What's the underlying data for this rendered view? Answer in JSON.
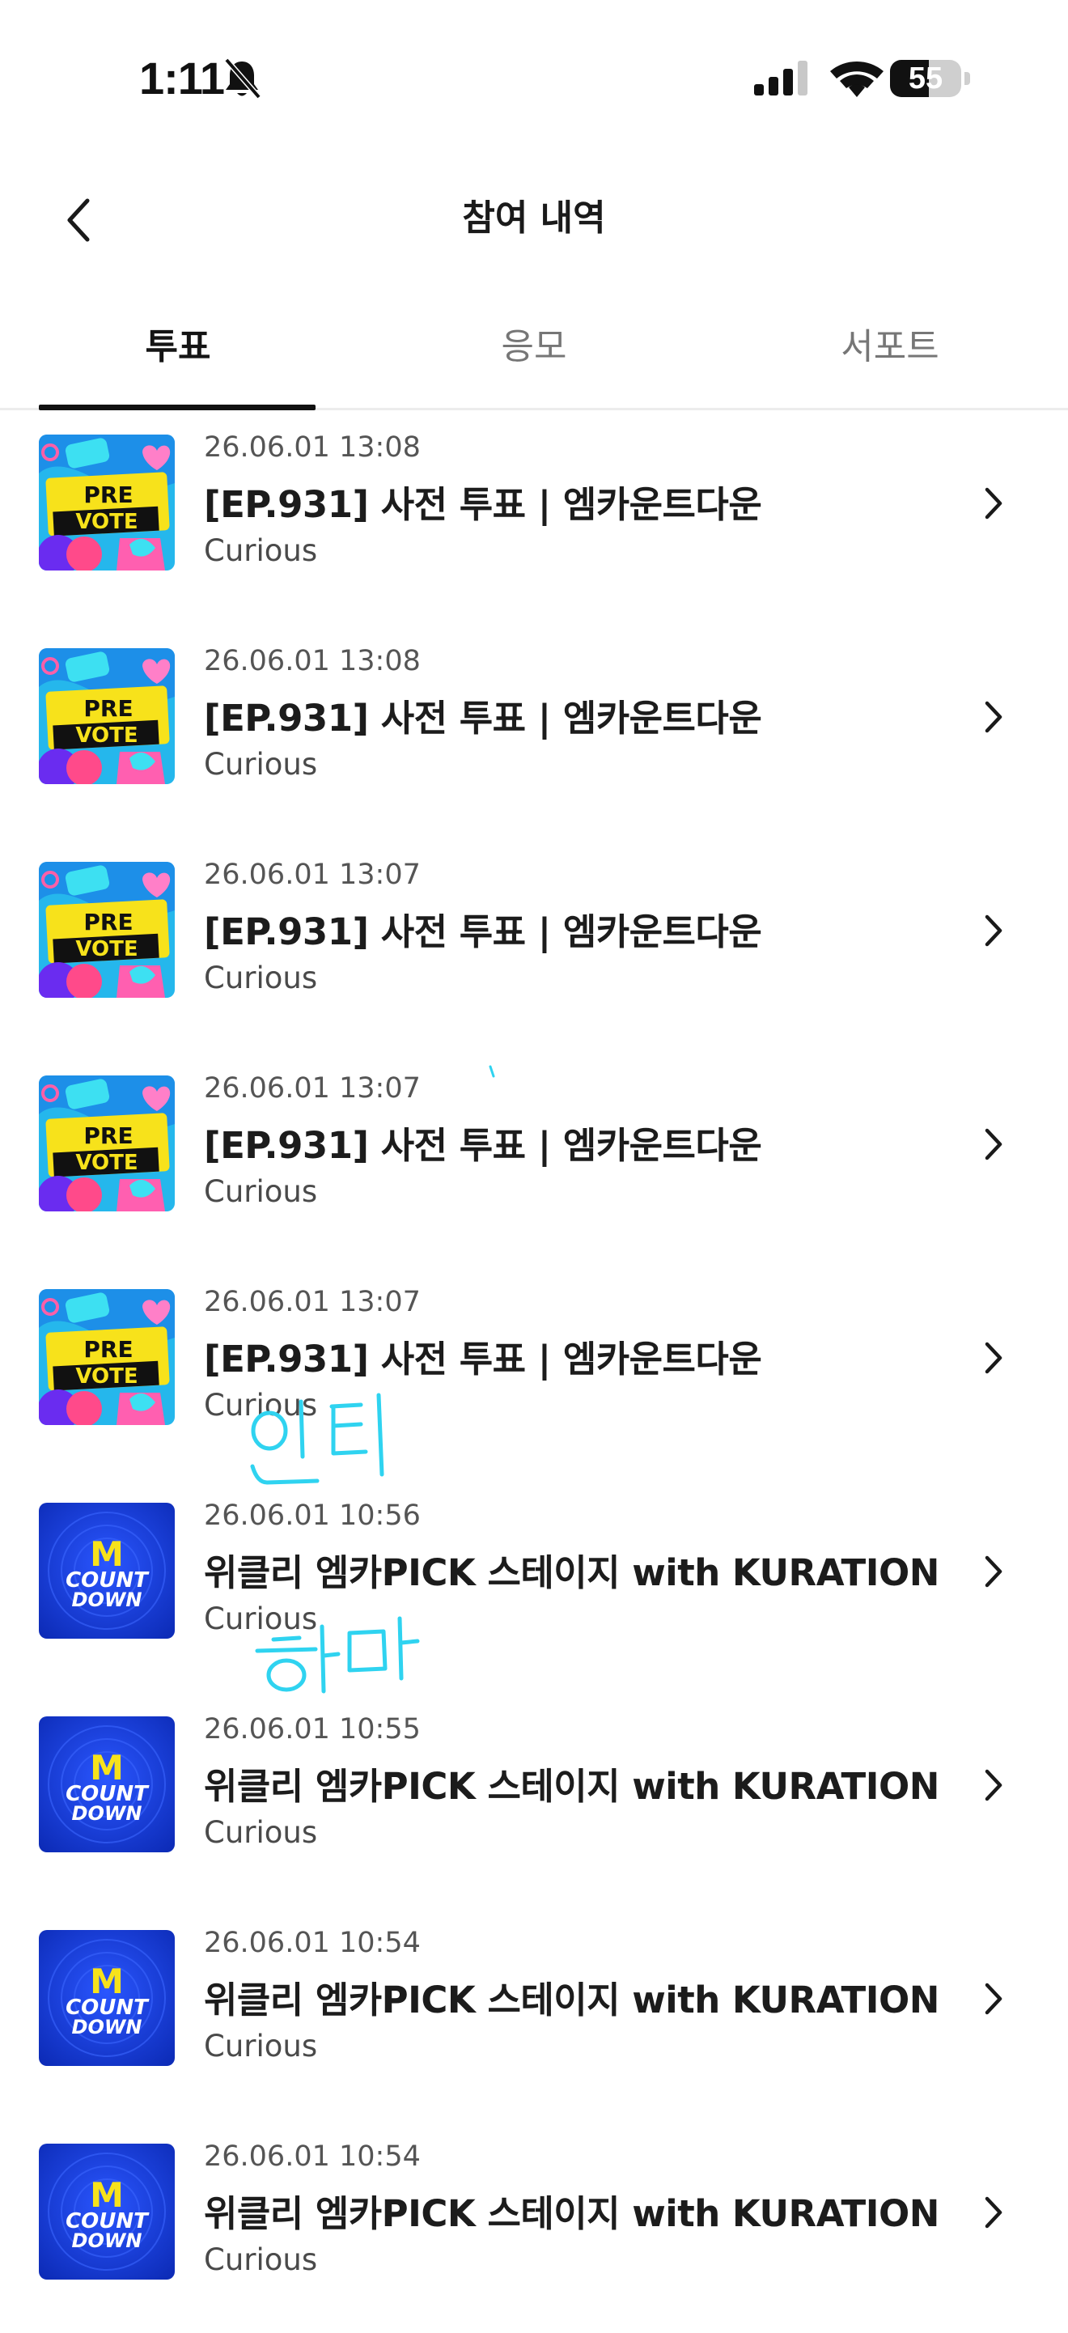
{
  "status_bar": {
    "time": "1:11",
    "battery_percent": "55",
    "battery_level": 0.55,
    "icons": [
      "bell-slash-icon",
      "cellular-signal-icon",
      "wifi-icon",
      "battery-icon"
    ]
  },
  "header": {
    "back_icon": "chevron-left-icon",
    "title": "참여 내역"
  },
  "tabs": [
    {
      "label": "투표",
      "active": true
    },
    {
      "label": "응모",
      "active": false
    },
    {
      "label": "서포트",
      "active": false
    }
  ],
  "items": [
    {
      "thumb": "pre-vote",
      "date": "26.06.01 13:08",
      "title": "[EP.931] 사전 투표 | 엠카운트다운",
      "sub": "Curious"
    },
    {
      "thumb": "pre-vote",
      "date": "26.06.01 13:08",
      "title": "[EP.931] 사전 투표 | 엠카운트다운",
      "sub": "Curious"
    },
    {
      "thumb": "pre-vote",
      "date": "26.06.01 13:07",
      "title": "[EP.931] 사전 투표 | 엠카운트다운",
      "sub": "Curious"
    },
    {
      "thumb": "pre-vote",
      "date": "26.06.01 13:07",
      "title": "[EP.931] 사전 투표 | 엠카운트다운",
      "sub": "Curious"
    },
    {
      "thumb": "pre-vote",
      "date": "26.06.01 13:07",
      "title": "[EP.931] 사전 투표 | 엠카운트다운",
      "sub": "Curious"
    },
    {
      "thumb": "mcountdown",
      "date": "26.06.01 10:56",
      "title": "위클리 엠카PICK 스테이지 with KURATION",
      "sub": "Curious"
    },
    {
      "thumb": "mcountdown",
      "date": "26.06.01 10:55",
      "title": "위클리 엠카PICK 스테이지 with KURATION",
      "sub": "Curious"
    },
    {
      "thumb": "mcountdown",
      "date": "26.06.01 10:54",
      "title": "위클리 엠카PICK 스테이지 with KURATION",
      "sub": "Curious"
    },
    {
      "thumb": "mcountdown",
      "date": "26.06.01 10:54",
      "title": "위클리 엠카PICK 스테이지 with KURATION",
      "sub": "Curious"
    }
  ],
  "thumbnails": {
    "pre_vote": {
      "line1": "PRE",
      "line2": "VOTE"
    },
    "mcountdown": {
      "logo": "M",
      "line1": "COUNT",
      "line2": "DOWN"
    }
  },
  "handwriting": [
    "인티",
    "하마"
  ],
  "colors": {
    "accent": "#111111",
    "inactive_tab": "#767676",
    "divider": "#ececec",
    "handwriting": "#2fd3f0",
    "mcd_blue": "#1f3bd6",
    "prevote_yellow": "#f7e21b"
  }
}
